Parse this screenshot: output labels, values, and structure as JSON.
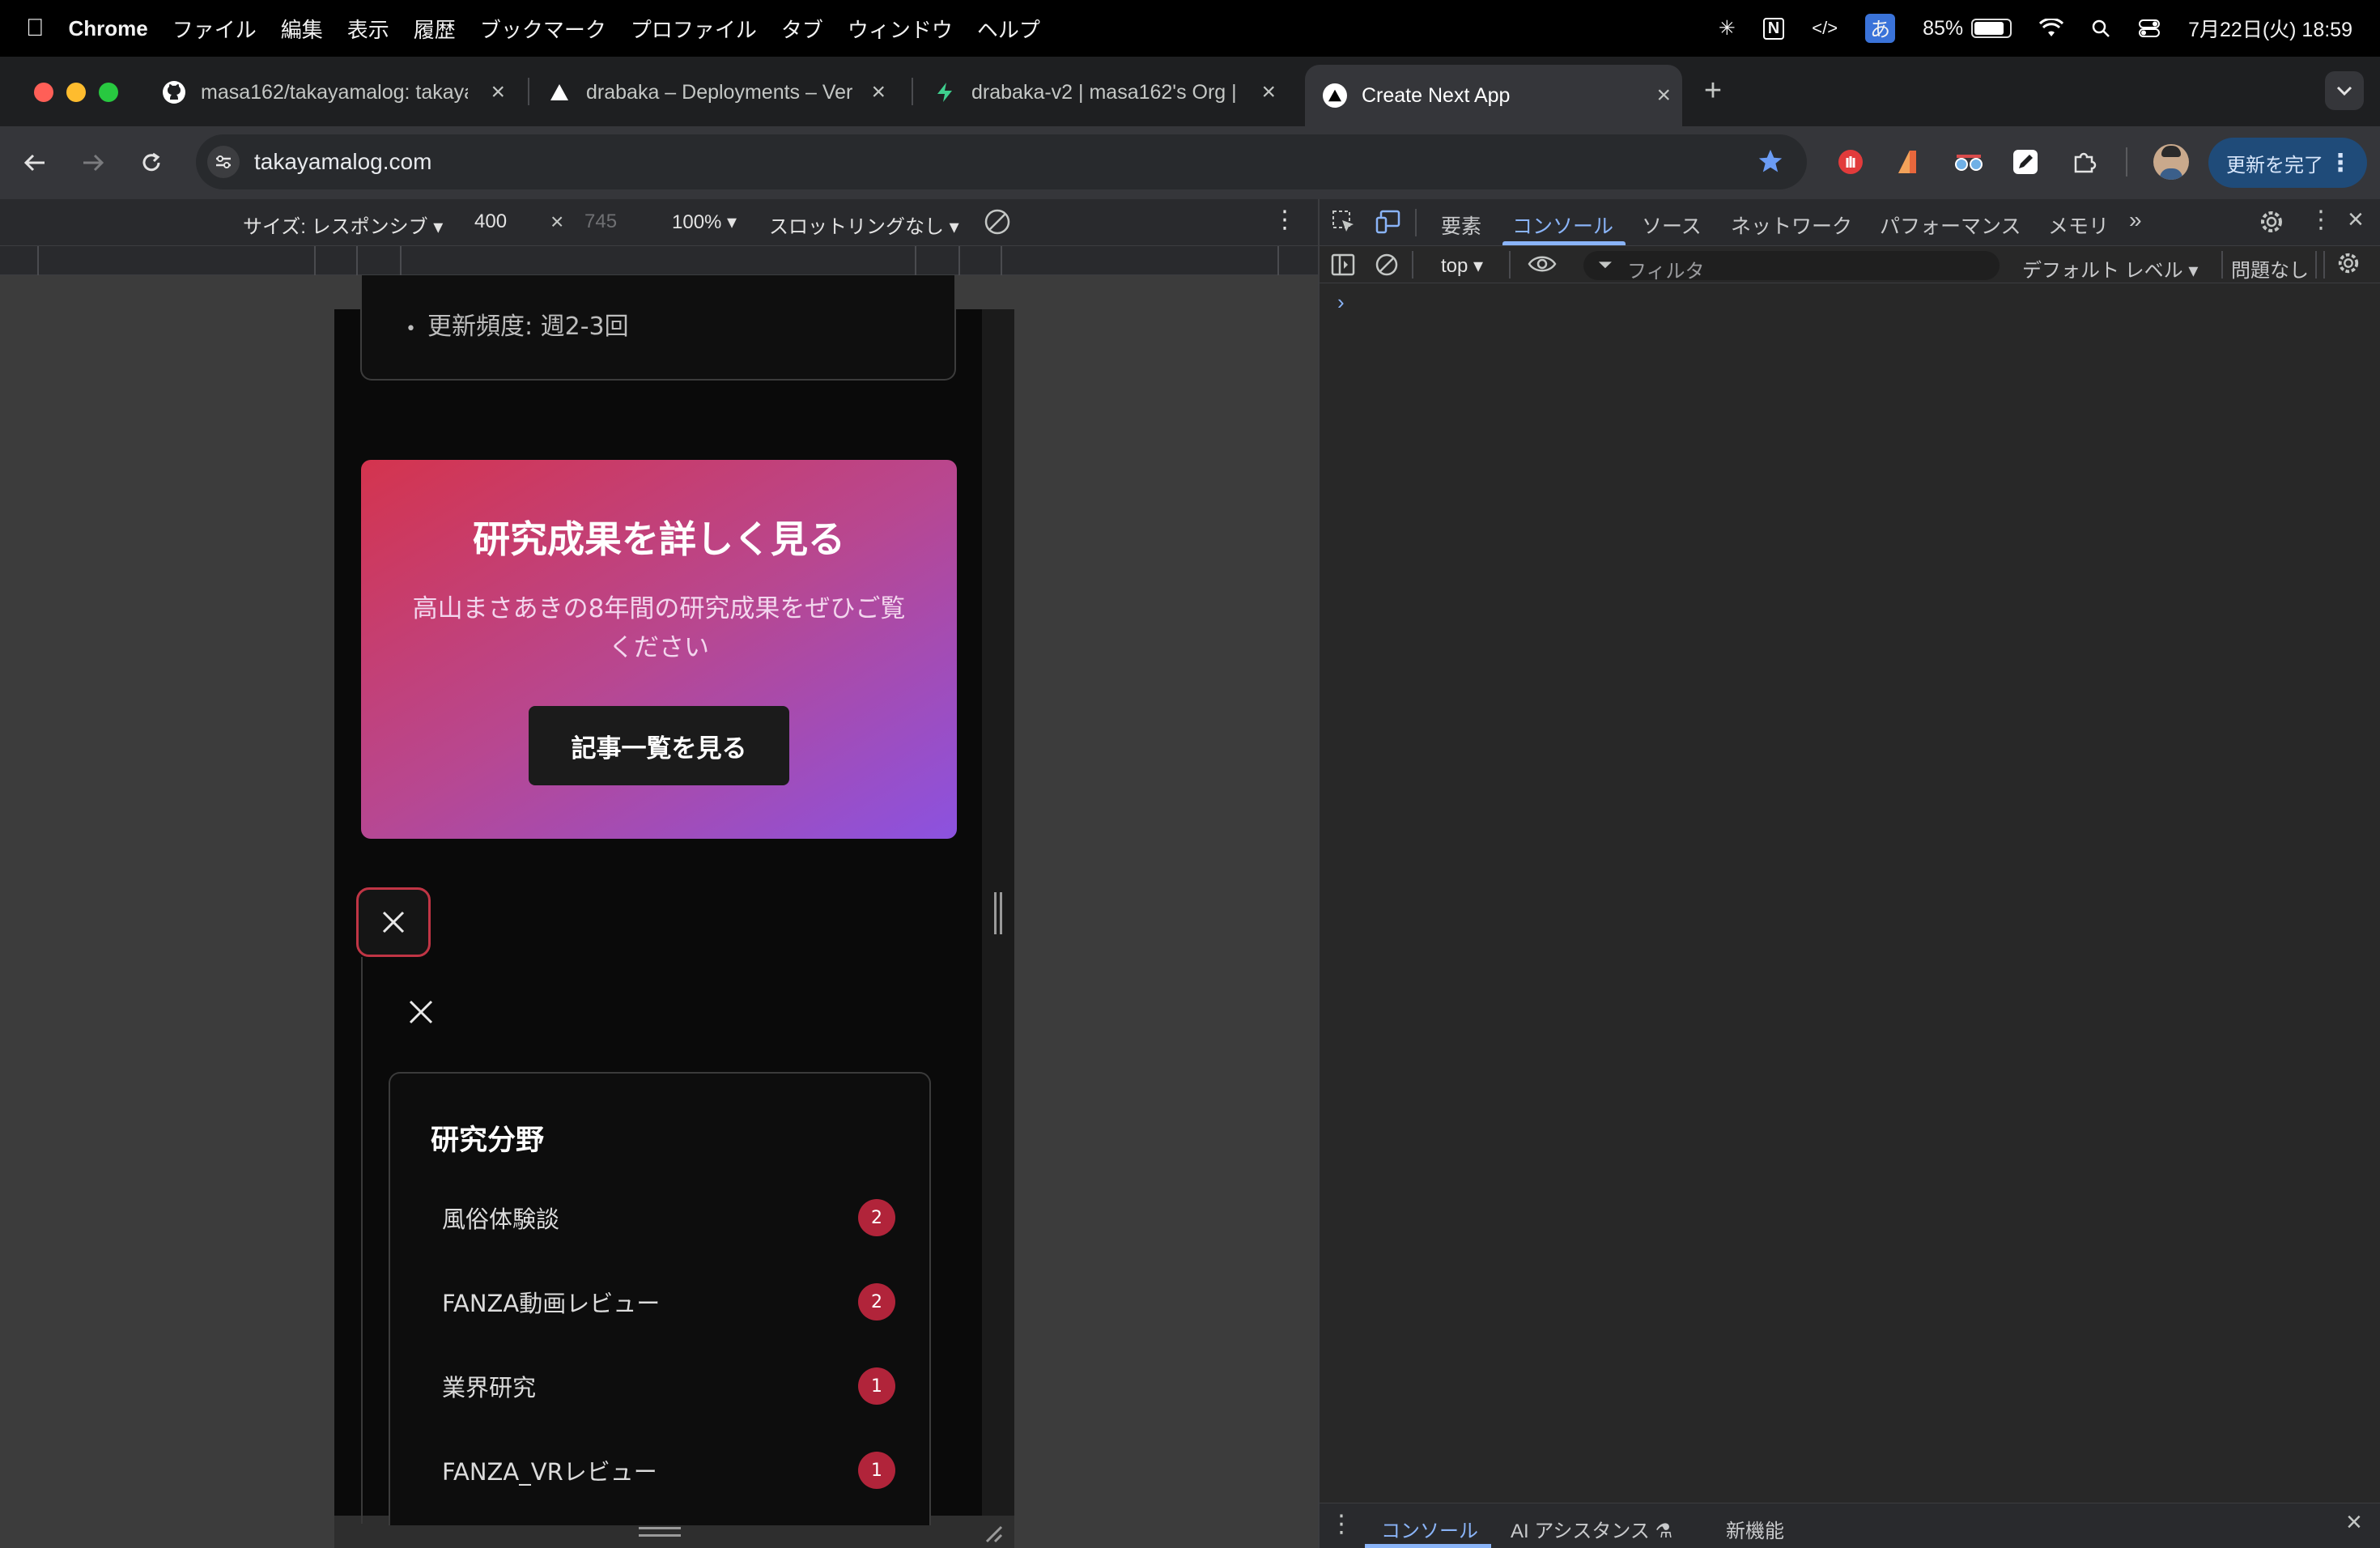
{
  "menubar": {
    "app": "Chrome",
    "items": [
      "ファイル",
      "編集",
      "表示",
      "履歴",
      "ブックマーク",
      "プロファイル",
      "タブ",
      "ウィンドウ",
      "ヘルプ"
    ],
    "battery": "85%",
    "datetime": "7月22日(火)  18:59",
    "ime": "あ"
  },
  "tabs": [
    {
      "title": "masa162/takayamalog: takaya",
      "icon": "github-icon"
    },
    {
      "title": "drabaka – Deployments – Ver",
      "icon": "vercel-icon"
    },
    {
      "title": "drabaka-v2 | masa162's Org |",
      "icon": "supabase-icon"
    },
    {
      "title": "Create Next App",
      "icon": "vercel-icon",
      "active": true
    }
  ],
  "toolbar": {
    "url": "takayamalog.com",
    "update_label": "更新を完了"
  },
  "device_toolbar": {
    "size_label": "サイズ: レスポンシブ",
    "width": "400",
    "height_placeholder": "745",
    "zoom": "100%",
    "throttle": "スロットリングなし"
  },
  "page": {
    "frequency_item": "更新頻度: 週2-3回",
    "hero": {
      "title": "研究成果を詳しく見る",
      "description": "高山まさあきの8年間の研究成果をぜひご覧ください",
      "button": "記事一覧を見る"
    },
    "categories": {
      "title": "研究分野",
      "items": [
        {
          "label": "風俗体験談",
          "count": "2"
        },
        {
          "label": "FANZA動画レビュー",
          "count": "2"
        },
        {
          "label": "業界研究",
          "count": "1"
        },
        {
          "label": "FANZA_VRレビュー",
          "count": "1"
        }
      ]
    }
  },
  "devtools": {
    "tabs": [
      "要素",
      "コンソール",
      "ソース",
      "ネットワーク",
      "パフォーマンス",
      "メモリ"
    ],
    "active_tab": "コンソール",
    "context": "top",
    "filter_placeholder": "フィルタ",
    "level": "デフォルト レベル",
    "issues": "問題なし",
    "drawer_tabs": [
      "コンソール",
      "AI アシスタンス",
      "新機能"
    ]
  },
  "colors": {
    "accent_blue": "#8ab4f8",
    "badge_red": "#b1243a",
    "hero_gradient_start": "#d4344e",
    "hero_gradient_end": "#8b52e0"
  }
}
